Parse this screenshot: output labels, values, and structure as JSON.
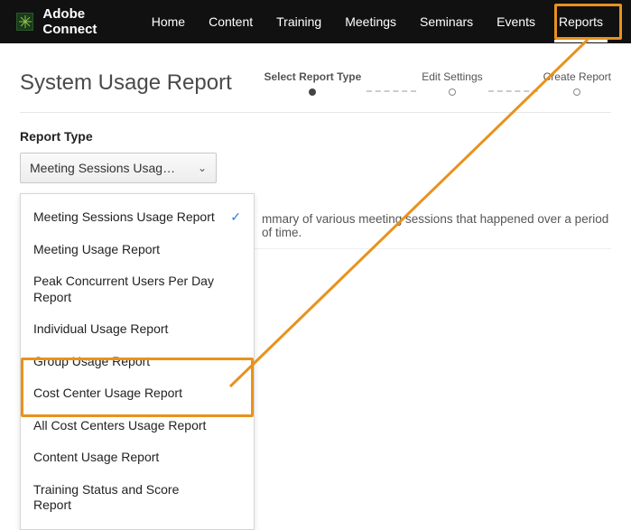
{
  "brand": "Adobe Connect",
  "nav": [
    {
      "label": "Home"
    },
    {
      "label": "Content"
    },
    {
      "label": "Training"
    },
    {
      "label": "Meetings"
    },
    {
      "label": "Seminars"
    },
    {
      "label": "Events"
    },
    {
      "label": "Reports",
      "active": true
    }
  ],
  "page": {
    "title": "System Usage Report",
    "steps": [
      {
        "label": "Select Report Type",
        "active": true
      },
      {
        "label": "Edit Settings"
      },
      {
        "label": "Create Report"
      }
    ]
  },
  "report_type": {
    "label": "Report Type",
    "selected_display": "Meeting Sessions Usag…",
    "options": [
      {
        "label": "Meeting Sessions Usage Report",
        "selected": true
      },
      {
        "label": "Meeting Usage Report"
      },
      {
        "label": "Peak Concurrent Users Per Day Report"
      },
      {
        "label": "Individual Usage Report"
      },
      {
        "label": "Group Usage Report"
      },
      {
        "label": "Cost Center Usage Report",
        "highlighted": true
      },
      {
        "label": "All Cost Centers Usage Report",
        "highlighted": true
      },
      {
        "label": "Content Usage Report"
      },
      {
        "label": "Training Status and Score Report"
      }
    ],
    "description": "mmary of various meeting sessions that happened over a period of time."
  },
  "annotation": {
    "highlight_nav": "Reports",
    "highlight_options": [
      "Cost Center Usage Report",
      "All Cost Centers Usage Report"
    ],
    "color": "#e8921c"
  }
}
